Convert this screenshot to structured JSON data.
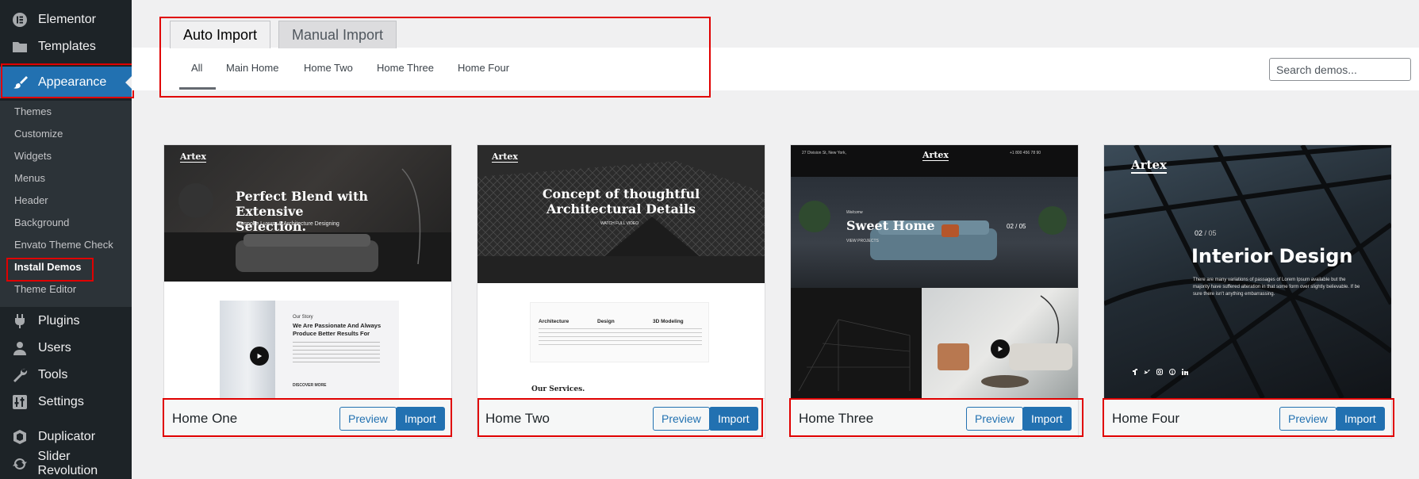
{
  "sidebar": {
    "items_top": [
      {
        "label": "Elementor",
        "icon": "elementor-icon"
      },
      {
        "label": "Templates",
        "icon": "folder-icon"
      }
    ],
    "appearance": {
      "label": "Appearance",
      "icon": "paintbrush-icon"
    },
    "submenu": [
      "Themes",
      "Customize",
      "Widgets",
      "Menus",
      "Header",
      "Background",
      "Envato Theme Check",
      "Install Demos",
      "Theme Editor"
    ],
    "items_bottom": [
      {
        "label": "Plugins",
        "icon": "plug-icon"
      },
      {
        "label": "Users",
        "icon": "user-icon"
      },
      {
        "label": "Tools",
        "icon": "wrench-icon"
      },
      {
        "label": "Settings",
        "icon": "settings-icon"
      },
      {
        "label": "Duplicator",
        "icon": "duplicator-icon"
      },
      {
        "label": "Slider Revolution",
        "icon": "refresh-icon"
      }
    ]
  },
  "tabs": {
    "auto": "Auto Import",
    "manual": "Manual Import"
  },
  "filters": [
    "All",
    "Main Home",
    "Home Two",
    "Home Three",
    "Home Four"
  ],
  "search": {
    "placeholder": "Search demos..."
  },
  "buttons": {
    "preview": "Preview",
    "import": "Import"
  },
  "demos": [
    {
      "name": "Home One",
      "brand": "Artex",
      "hero_line1": "Perfect Blend with",
      "hero_line2": "Extensive Selection.",
      "hero_sub": "Bespoke Luxury & Architecture Designing",
      "story_label": "Our Story",
      "story_title1": "We Are Passionate And Always",
      "story_title2": "Produce Better Results For",
      "discover": "DISCOVER MORE"
    },
    {
      "name": "Home Two",
      "brand": "Artex",
      "hero_line1": "Concept of thoughtful",
      "hero_line2": "Architectural Details",
      "watch": "WATCH FULL VIDEO",
      "services": [
        "Architecture",
        "Design",
        "3D Modeling"
      ],
      "services_title": "Our Services."
    },
    {
      "name": "Home Three",
      "brand": "Artex",
      "address": "27 Division St, New York,",
      "phone": "+1 800 456 78 90",
      "hero_pre": "Welcome",
      "hero_title": "Sweet Home",
      "counter": "02 / 05",
      "view": "VIEW PROJECTS"
    },
    {
      "name": "Home Four",
      "brand": "Artex",
      "counter_a": "02",
      "counter_b": "05",
      "hero_title": "Interior Design",
      "hero_text": "There are many variations of passages of Lorem Ipsum available but the majority have suffered alteration in that some form over slightly believable. If be sure there isn't anything embarrassing."
    }
  ],
  "colors": {
    "sidebar_bg": "#1d2327",
    "submenu_bg": "#2c3338",
    "accent": "#2271b1",
    "highlight": "#e00000"
  }
}
